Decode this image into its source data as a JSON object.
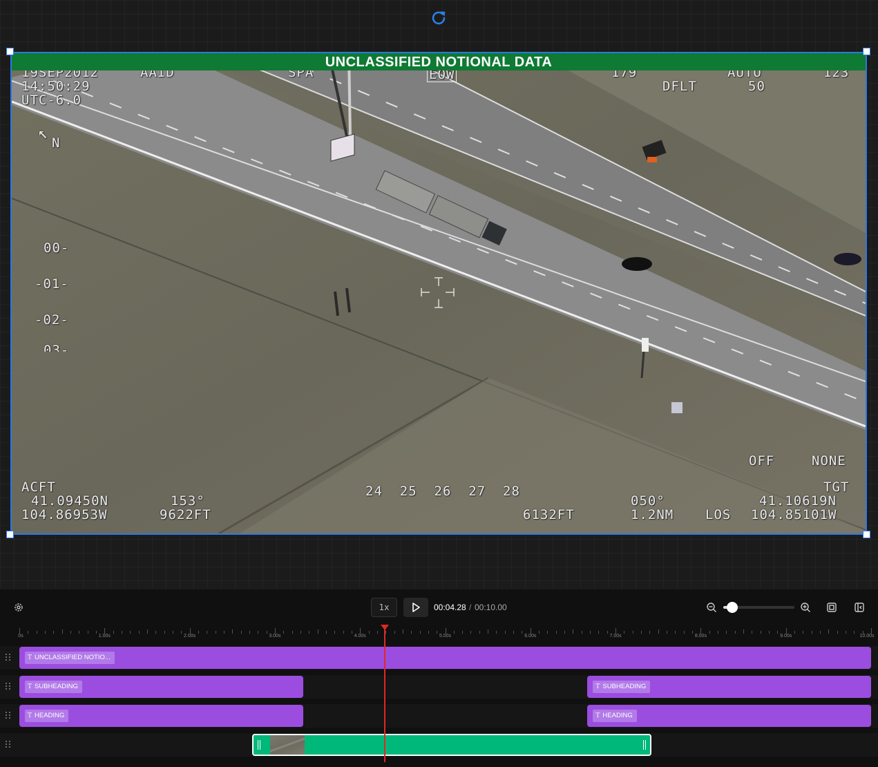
{
  "canvas": {
    "refresh_icon": "refresh-icon",
    "selection_color": "#2b78e4",
    "video": {
      "banner": "UNCLASSIFIED NOTIONAL DATA",
      "banner_color": "#0e7a33",
      "hud": {
        "date": "19SEP2012",
        "mode_left": "AAID",
        "time": "14:50:29",
        "utc": "UTC-6.0",
        "mode_spa": "SPA",
        "mode_eow": "EOW",
        "heading_top": "179",
        "dflt": "DFLT",
        "auto": "AUTO",
        "auto_val": "50",
        "top_right": "123",
        "north": "N",
        "pitch_00": "00-",
        "pitch_01": "-01-",
        "pitch_02": "-02-",
        "pitch_03": "03-",
        "off": "OFF",
        "none": "NONE",
        "acft": "ACFT",
        "acft_lat": "41.09450N",
        "acft_lon": "104.86953W",
        "acft_hdg": "153°",
        "acft_alt": "9622FT",
        "scale": "24  25  26  27  28",
        "slant_range": "6132FT",
        "tgt_bearing": "050°",
        "tgt_dist": "1.2NM",
        "los": "LOS",
        "tgt": "TGT",
        "tgt_lat": "41.10619N",
        "tgt_lon": "104.85101W"
      }
    }
  },
  "timeline": {
    "settings_icon": "settings-icon",
    "speed": "1x",
    "play_icon": "play-icon",
    "current_time": "00:04.28",
    "separator": "/",
    "total_time": "00:10.00",
    "zoom_out_icon": "zoom-out-icon",
    "zoom_in_icon": "zoom-in-icon",
    "zoom_level": 0.13,
    "fit_icon": "fit-to-screen-icon",
    "collapse_icon": "panel-collapse-icon",
    "ruler_labels": [
      "0s",
      "1.00s",
      "2.00s",
      "3.00s",
      "4.00s",
      "5.00s",
      "6.00s",
      "7.00s",
      "8.00s",
      "9.00s",
      "10.00s"
    ],
    "playhead_seconds": 4.28,
    "duration_seconds": 10,
    "tracks": [
      {
        "clips": [
          {
            "label": "UNCLASSIFIED NOTIO...",
            "type": "text",
            "start": 0,
            "end": 10
          }
        ]
      },
      {
        "clips": [
          {
            "label": "SUBHEADING",
            "type": "text",
            "start": 0,
            "end": 3.33
          },
          {
            "label": "SUBHEADING",
            "type": "text",
            "start": 6.67,
            "end": 10
          }
        ]
      },
      {
        "clips": [
          {
            "label": "HEADING",
            "type": "text",
            "start": 0,
            "end": 3.33
          },
          {
            "label": "HEADING",
            "type": "text",
            "start": 6.67,
            "end": 10
          }
        ]
      },
      {
        "clips": [
          {
            "type": "video",
            "start": 2.73,
            "end": 7.42
          }
        ]
      }
    ],
    "colors": {
      "text_clip": "#9b4de0",
      "video_clip": "#00b87a",
      "playhead": "#e12727"
    }
  }
}
